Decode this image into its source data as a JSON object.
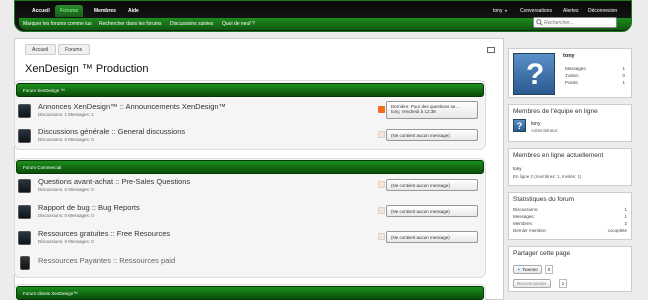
{
  "nav": {
    "tabs": [
      "Accueil",
      "Forums",
      "Membres",
      "Aide"
    ],
    "user": "tony",
    "conversations": "Conversations",
    "alerts": "Alertes",
    "logout": "Déconnexion",
    "sub": [
      "Marquer les forums comme lus",
      "Rechercher dans les forums",
      "Discussions suivies",
      "Quoi de neuf ?"
    ],
    "search_placeholder": "Rechercher..."
  },
  "breadcrumb": [
    "Accueil",
    "Forums"
  ],
  "page_title": "XenDesign ™ Production",
  "categories": [
    {
      "title": "Forum XenDesign ™",
      "forums": [
        {
          "title": "Annonces XenDesign™ :: Announcements XenDesign™",
          "stats": "Discussions: 1 Messages: 1",
          "last_line1": "Dernière: Pour des questions se...",
          "last_line2": "tony, Vendredi à 12:38"
        },
        {
          "title": "Discussions générale :: General discussions",
          "stats": "Discussions: 0 Messages: 0",
          "last": "(Ne contient aucun message)"
        }
      ]
    },
    {
      "title": "Forum Commercial",
      "forums": [
        {
          "title": "Questions avant-achat :: Pre-Sales Questions",
          "stats": "Discussions: 0 Messages: 0",
          "last": "(Ne contient aucun message)"
        },
        {
          "title": "Rapport de bug :: Bug Reports",
          "stats": "Discussions: 0 Messages: 0",
          "last": "(Ne contient aucun message)"
        },
        {
          "title": "Ressources gratuites :: Free Resources",
          "stats": "Discussions: 0 Messages: 0",
          "last": "(Ne contient aucun message)"
        },
        {
          "title": "Ressources Payantes :: Ressources paid"
        }
      ]
    },
    {
      "title": "Forum clients XenDesign™"
    }
  ],
  "sidebar": {
    "visitor": {
      "name": "tony",
      "rows": [
        {
          "label": "Messages:",
          "value": "1"
        },
        {
          "label": "J'aime:",
          "value": "0"
        },
        {
          "label": "Points:",
          "value": "1"
        }
      ]
    },
    "staff": {
      "title": "Membres de l'équipe en ligne",
      "name": "tony",
      "role": "Administrator"
    },
    "online": {
      "title": "Membres en ligne actuellement",
      "name": "tony",
      "summary": "En ligne 2 (membres: 1, Invités: 1)"
    },
    "stats": {
      "title": "Statistiques du forum",
      "rows": [
        {
          "label": "Discussions:",
          "value": "1"
        },
        {
          "label": "Messages:",
          "value": "1"
        },
        {
          "label": "Membres:",
          "value": "2"
        },
        {
          "label": "Dernier membre:",
          "value": "cocoplete"
        }
      ]
    },
    "share": {
      "title": "Partager cette page",
      "tweet": "Tweeter",
      "tweet_count": "0",
      "recommend": "Recommander",
      "recommend_count": "1"
    }
  },
  "colors": {
    "accent": "#1b8f1b",
    "nav_bg": "#0a0a0a"
  }
}
